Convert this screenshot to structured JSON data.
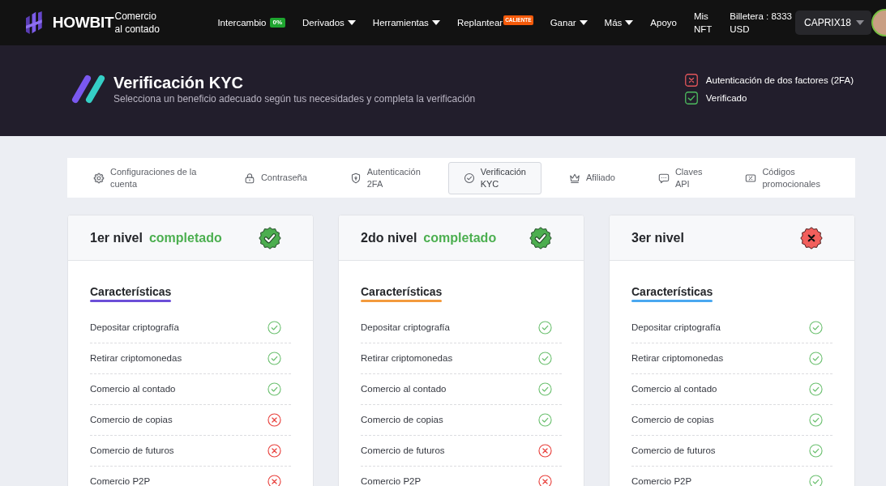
{
  "navbar": {
    "brand": "HOWBIT",
    "brand_subtitle": "Comercio al contado",
    "items": [
      {
        "label": "Intercambio",
        "dropdown": false,
        "badge": {
          "label": "0%",
          "color": "#1ea52f"
        }
      },
      {
        "label": "Derivados",
        "dropdown": true
      },
      {
        "label": "Herramientas",
        "dropdown": true
      },
      {
        "label": "Replantear",
        "dropdown": false,
        "badge": {
          "label": "CALIENTE",
          "color": "#f45a0a"
        }
      },
      {
        "label": "Ganar",
        "dropdown": true
      },
      {
        "label": "Más",
        "dropdown": true
      },
      {
        "label": "Apoyo",
        "dropdown": false
      },
      {
        "label": "Mis NFT",
        "dropdown": false
      }
    ],
    "wallet": "Billetera : 8333 USD",
    "user": {
      "name": "CAPRIX18",
      "dropdown": true
    }
  },
  "header": {
    "title": "Verificación KYC",
    "subtitle": "Selecciona un beneficio adecuado según tus necesidades y completa la verificación",
    "statuses": [
      {
        "label": "Autenticación de dos factores (2FA)",
        "done": false
      },
      {
        "label": "Verificado",
        "done": true
      }
    ]
  },
  "tabs": [
    {
      "label": "Configuraciones de la cuenta",
      "kind": "settings",
      "selected": false
    },
    {
      "label": "Contraseña",
      "kind": "password",
      "selected": false
    },
    {
      "label": "Autenticación 2FA",
      "kind": "twofactor",
      "selected": false
    },
    {
      "label": "Verificación KYC",
      "kind": "kyc",
      "selected": true
    },
    {
      "label": "Afiliado",
      "kind": "affiliate",
      "selected": false
    },
    {
      "label": "Claves API",
      "kind": "api",
      "selected": false
    },
    {
      "label": "Códigos promocionales",
      "kind": "promo",
      "selected": false
    }
  ],
  "levels": [
    {
      "title": "1er nivel",
      "status": "completado",
      "completed": true,
      "color": "#6c4fd8",
      "heading": "Características",
      "features": [
        {
          "label": "Depositar criptografía",
          "available": true
        },
        {
          "label": "Retirar criptomonedas",
          "available": true
        },
        {
          "label": "Comercio al contado",
          "available": true
        },
        {
          "label": "Comercio de copias",
          "available": false
        },
        {
          "label": "Comercio de futuros",
          "available": false
        },
        {
          "label": "Comercio P2P",
          "available": false
        }
      ]
    },
    {
      "title": "2do nivel",
      "status": "completado",
      "completed": true,
      "color": "#f39a3d",
      "heading": "Características",
      "features": [
        {
          "label": "Depositar criptografía",
          "available": true
        },
        {
          "label": "Retirar criptomonedas",
          "available": true
        },
        {
          "label": "Comercio al contado",
          "available": true
        },
        {
          "label": "Comercio de copias",
          "available": true
        },
        {
          "label": "Comercio de futuros",
          "available": false
        },
        {
          "label": "Comercio P2P",
          "available": false
        }
      ]
    },
    {
      "title": "3er nivel",
      "completed": false,
      "color": "#4aa8f0",
      "heading": "Características",
      "features": [
        {
          "label": "Depositar criptografía",
          "available": true
        },
        {
          "label": "Retirar criptomonedas",
          "available": true
        },
        {
          "label": "Comercio al contado",
          "available": true
        },
        {
          "label": "Comercio de copias",
          "available": true
        },
        {
          "label": "Comercio de futuros",
          "available": true
        },
        {
          "label": "Comercio P2P",
          "available": true
        }
      ]
    }
  ]
}
